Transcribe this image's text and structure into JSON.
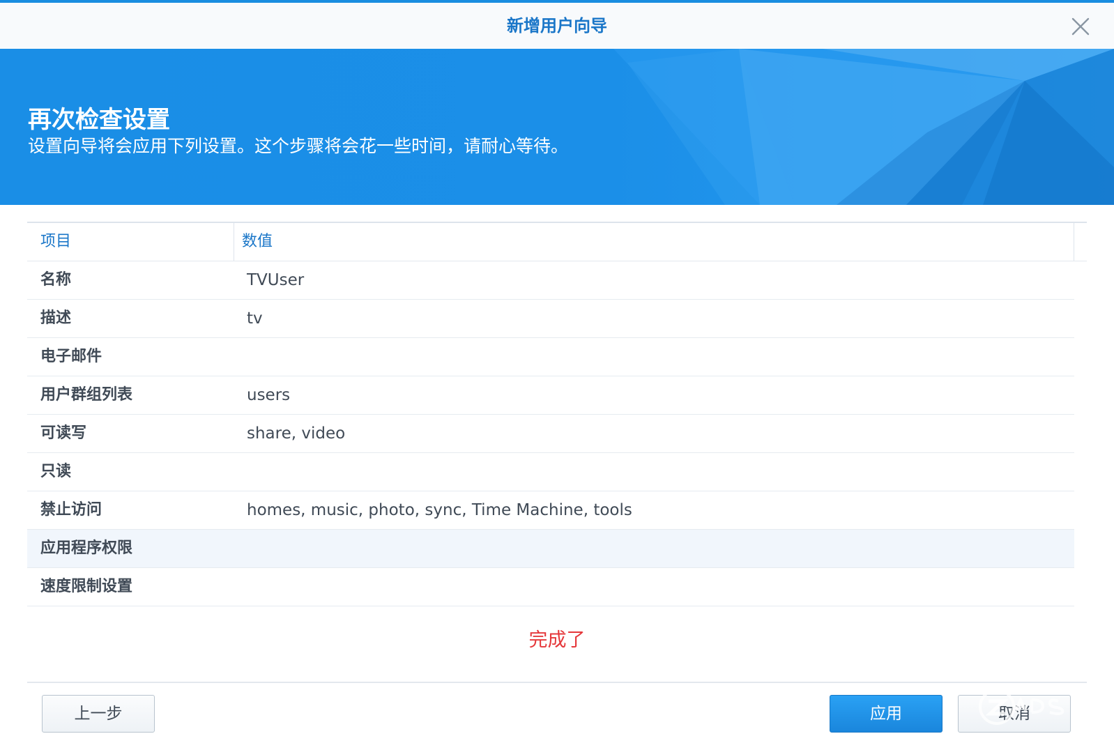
{
  "window": {
    "title": "新增用户向导"
  },
  "banner": {
    "title": "再次检查设置",
    "subtitle": "设置向导将会应用下列设置。这个步骤将会花一些时间，请耐心等待。"
  },
  "table": {
    "headers": [
      "项目",
      "数值"
    ],
    "rows": [
      {
        "key": "名称",
        "value": "TVUser"
      },
      {
        "key": "描述",
        "value": "tv"
      },
      {
        "key": "电子邮件",
        "value": ""
      },
      {
        "key": "用户群组列表",
        "value": "users"
      },
      {
        "key": "可读写",
        "value": "share, video"
      },
      {
        "key": "只读",
        "value": ""
      },
      {
        "key": "禁止访问",
        "value": "homes, music, photo, sync, Time Machine, tools"
      },
      {
        "key": "应用程序权限",
        "value": "",
        "highlighted": true
      },
      {
        "key": "速度限制设置",
        "value": ""
      }
    ]
  },
  "status": {
    "done_text": "完成了"
  },
  "buttons": {
    "back": "上一步",
    "apply": "应用",
    "cancel": "取消"
  },
  "icons": {
    "close": "close-icon",
    "watermark": "znds-watermark-icon"
  },
  "colors": {
    "accent": "#1a8de0",
    "banner": "#1a8ee6",
    "title_text": "#1a76c8",
    "done_text": "#e5383b",
    "apply_button": "#1a86dc"
  }
}
